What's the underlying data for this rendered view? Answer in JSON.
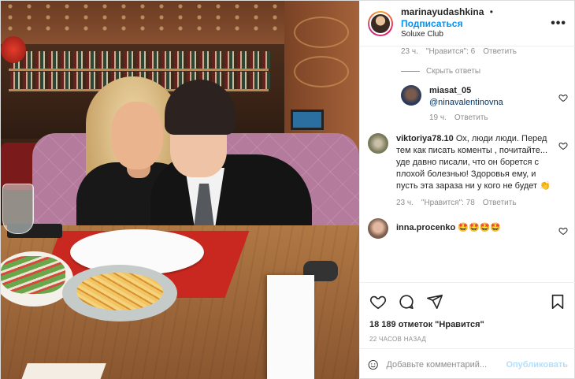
{
  "header": {
    "username": "marinayudashkina",
    "follow_label": "Подписаться",
    "separator": "•",
    "location": "Soluxe Club",
    "more_label": "•••"
  },
  "comments": {
    "top_meta": {
      "time": "23 ч.",
      "likes": "\"Нравится\": 6",
      "reply": "Ответить"
    },
    "hide_replies": "Скрыть ответы",
    "reply": {
      "username": "miasat_05",
      "mention": "@ninavalentinovna",
      "time": "19 ч.",
      "reply_label": "Ответить"
    },
    "items": [
      {
        "username": "viktoriya78.10",
        "text": "Ох, люди люди. Перед тем как писать коменты , почитайте... уде давно писали, что он борется с плохой болезнью! Здоровья ему, и пусть эта зараза ни у кого не будет 👏",
        "time": "23 ч.",
        "likes": "\"Нравится\": 78",
        "reply_label": "Ответить"
      },
      {
        "username": "inna.procenko",
        "text": "🤩🤩🤩🤩"
      }
    ]
  },
  "icons": {
    "like": "heart-icon",
    "comment": "comment-icon",
    "share": "share-icon",
    "save": "bookmark-icon",
    "emoji": "emoji-icon",
    "more": "more-icon"
  },
  "likes": {
    "count": "18 189",
    "label": "отметок \"Нравится\""
  },
  "timestamp": "22 ЧАСОВ НАЗАД",
  "add_comment": {
    "placeholder": "Добавьте комментарий...",
    "publish_label": "Опубликовать"
  },
  "colors": {
    "link": "#0095f6",
    "publish_disabled": "#b2dffc",
    "muted": "#8e8e8e",
    "text": "#262626"
  }
}
